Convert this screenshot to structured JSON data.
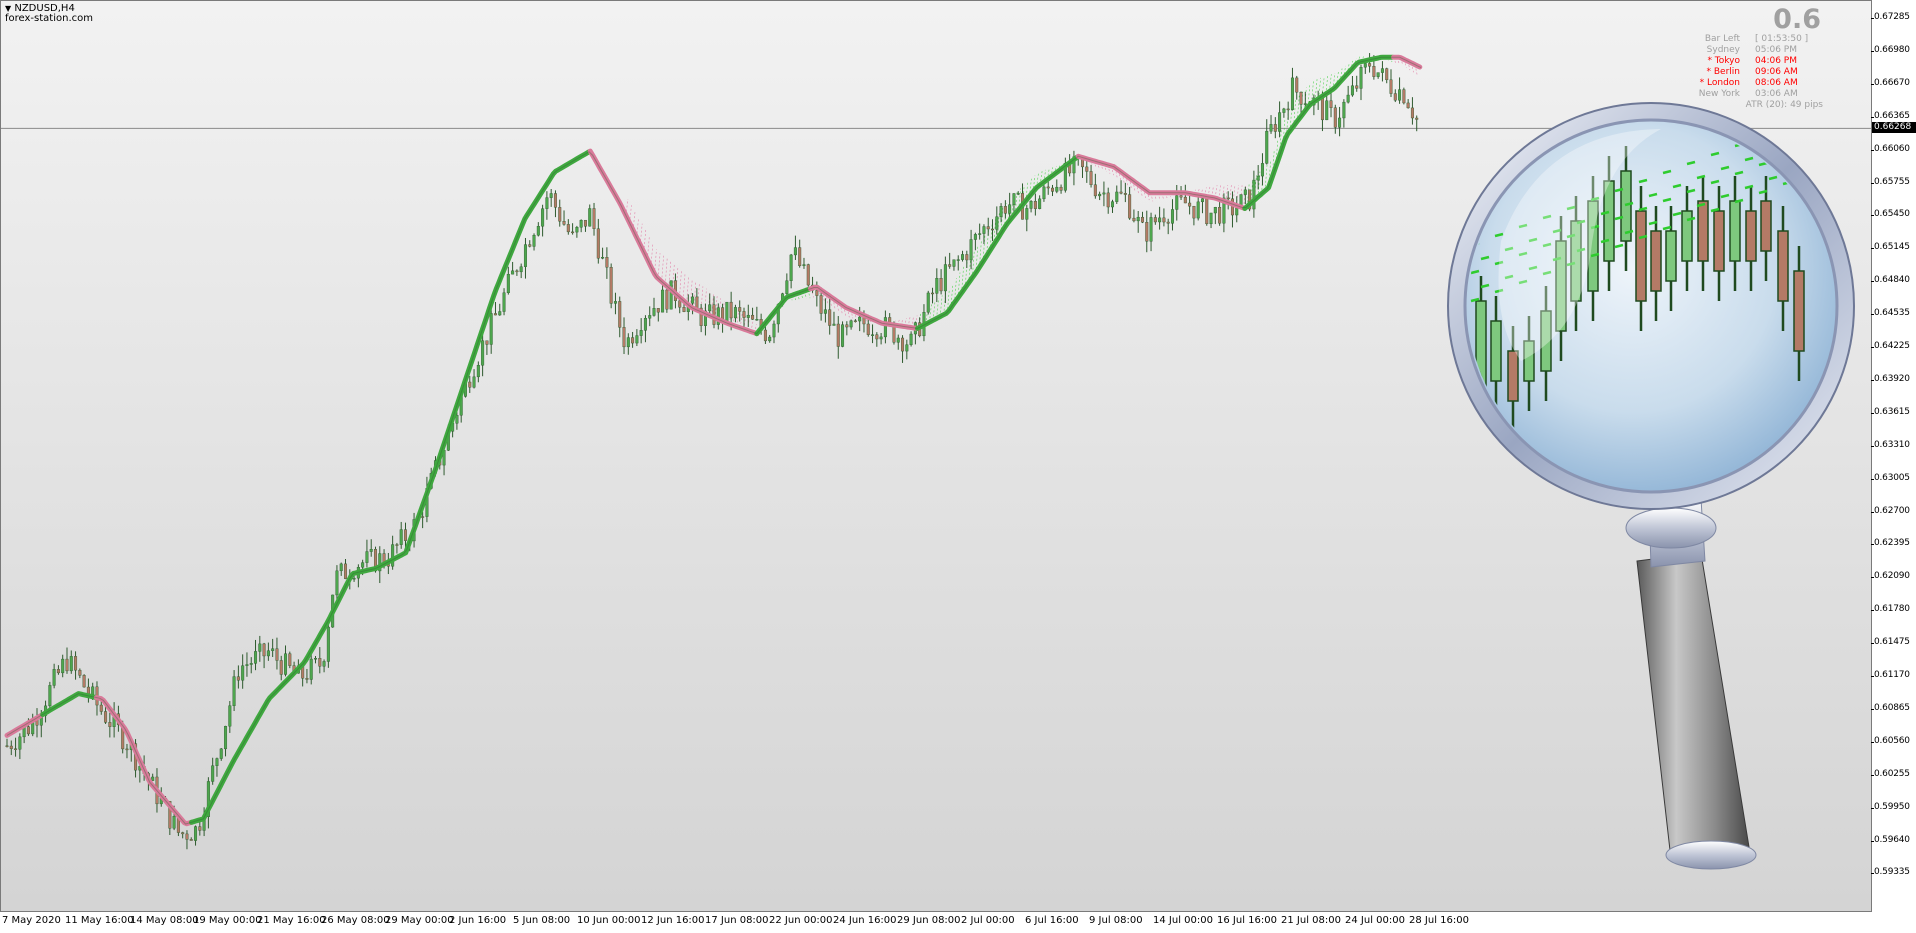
{
  "window": {
    "symbol_label": "NZDUSD,H4",
    "watermark": "forex-station.com",
    "menu_icon": "triangle-down-icon"
  },
  "info_panel": {
    "big_value": "0.6",
    "rows": [
      {
        "label": "Bar Left",
        "value": "[ 01:53:50 ]",
        "color": "#a0a0a0"
      },
      {
        "label": "Sydney",
        "value": "05:06 PM",
        "color": "#a0a0a0"
      },
      {
        "label": "* Tokyo",
        "value": "04:06 PM",
        "color": "#ff0000"
      },
      {
        "label": "* Berlin",
        "value": "09:06 AM",
        "color": "#ff0000"
      },
      {
        "label": "* London",
        "value": "08:06 AM",
        "color": "#ff0000"
      },
      {
        "label": "New York",
        "value": "03:06 AM",
        "color": "#a0a0a0"
      }
    ],
    "atr": "ATR (20): 49 pips"
  },
  "price_axis": {
    "ticks": [
      "0.67285",
      "0.66980",
      "0.66670",
      "0.66365",
      "0.66060",
      "0.65755",
      "0.65450",
      "0.65145",
      "0.64840",
      "0.64535",
      "0.64225",
      "0.63920",
      "0.63615",
      "0.63310",
      "0.63005",
      "0.62700",
      "0.62395",
      "0.62090",
      "0.61780",
      "0.61475",
      "0.61170",
      "0.60865",
      "0.60560",
      "0.60255",
      "0.59950",
      "0.59640",
      "0.59335"
    ],
    "current_price": "0.66268"
  },
  "time_axis": {
    "labels": [
      "7 May 2020",
      "11 May 16:00",
      "14 May 08:00",
      "19 May 00:00",
      "21 May 16:00",
      "26 May 08:00",
      "29 May 00:00",
      "2 Jun 16:00",
      "5 Jun 08:00",
      "10 Jun 00:00",
      "12 Jun 16:00",
      "17 Jun 08:00",
      "22 Jun 00:00",
      "24 Jun 16:00",
      "29 Jun 08:00",
      "2 Jul 00:00",
      "6 Jul 16:00",
      "9 Jul 08:00",
      "14 Jul 00:00",
      "16 Jul 16:00",
      "21 Jul 08:00",
      "24 Jul 00:00",
      "28 Jul 16:00"
    ]
  },
  "colors": {
    "bull_candle": "#4ea64e",
    "bear_candle": "#b47a66",
    "ma_up": "#3fa83f",
    "ma_down": "#d97a9a",
    "cloud_up": "#2ecc2e",
    "cloud_down": "#e06a9a"
  },
  "overlay": {
    "icon": "magnifying-glass-icon"
  },
  "chart_data": {
    "type": "candlestick",
    "symbol": "NZDUSD",
    "timeframe": "H4",
    "ylim": [
      0.5915,
      0.6745
    ],
    "x_labels": [
      "7 May 2020",
      "11 May 16:00",
      "14 May 08:00",
      "19 May 00:00",
      "21 May 16:00",
      "26 May 08:00",
      "29 May 00:00",
      "2 Jun 16:00",
      "5 Jun 08:00",
      "10 Jun 00:00",
      "12 Jun 16:00",
      "17 Jun 08:00",
      "22 Jun 00:00",
      "24 Jun 16:00",
      "29 Jun 08:00",
      "2 Jul 00:00",
      "6 Jul 16:00",
      "9 Jul 08:00",
      "14 Jul 00:00",
      "16 Jul 16:00",
      "21 Jul 08:00",
      "24 Jul 00:00",
      "28 Jul 16:00"
    ],
    "close_path": [
      [
        0,
        0.6035
      ],
      [
        20,
        0.6055
      ],
      [
        50,
        0.6118
      ],
      [
        75,
        0.6075
      ],
      [
        100,
        0.604
      ],
      [
        120,
        0.6
      ],
      [
        145,
        0.595
      ],
      [
        160,
        0.5955
      ],
      [
        175,
        0.602
      ],
      [
        195,
        0.611
      ],
      [
        220,
        0.6125
      ],
      [
        245,
        0.61
      ],
      [
        265,
        0.6115
      ],
      [
        275,
        0.6195
      ],
      [
        295,
        0.621
      ],
      [
        320,
        0.6215
      ],
      [
        345,
        0.625
      ],
      [
        365,
        0.6315
      ],
      [
        390,
        0.6395
      ],
      [
        410,
        0.6445
      ],
      [
        430,
        0.65
      ],
      [
        455,
        0.6565
      ],
      [
        475,
        0.652
      ],
      [
        490,
        0.6545
      ],
      [
        510,
        0.6455
      ],
      [
        520,
        0.642
      ],
      [
        535,
        0.645
      ],
      [
        560,
        0.647
      ],
      [
        585,
        0.6445
      ],
      [
        610,
        0.645
      ],
      [
        625,
        0.644
      ],
      [
        640,
        0.643
      ],
      [
        660,
        0.651
      ],
      [
        680,
        0.646
      ],
      [
        700,
        0.6425
      ],
      [
        720,
        0.644
      ],
      [
        740,
        0.6435
      ],
      [
        760,
        0.642
      ],
      [
        780,
        0.6475
      ],
      [
        800,
        0.65
      ],
      [
        820,
        0.653
      ],
      [
        840,
        0.6555
      ],
      [
        860,
        0.655
      ],
      [
        880,
        0.6575
      ],
      [
        900,
        0.659
      ],
      [
        920,
        0.6565
      ],
      [
        940,
        0.656
      ],
      [
        955,
        0.6525
      ],
      [
        970,
        0.6545
      ],
      [
        990,
        0.6555
      ],
      [
        1010,
        0.6545
      ],
      [
        1030,
        0.655
      ],
      [
        1045,
        0.656
      ],
      [
        1060,
        0.662
      ],
      [
        1080,
        0.6665
      ],
      [
        1100,
        0.665
      ],
      [
        1115,
        0.6635
      ],
      [
        1130,
        0.666
      ],
      [
        1145,
        0.669
      ],
      [
        1160,
        0.667
      ],
      [
        1175,
        0.666
      ],
      [
        1187,
        0.6628
      ]
    ],
    "ma_path": [
      [
        0,
        0.6045
      ],
      [
        30,
        0.6065
      ],
      [
        60,
        0.6085
      ],
      [
        80,
        0.608
      ],
      [
        100,
        0.605
      ],
      [
        120,
        0.6
      ],
      [
        150,
        0.596
      ],
      [
        165,
        0.5965
      ],
      [
        190,
        0.602
      ],
      [
        220,
        0.608
      ],
      [
        250,
        0.6115
      ],
      [
        270,
        0.6155
      ],
      [
        290,
        0.62
      ],
      [
        310,
        0.6205
      ],
      [
        335,
        0.622
      ],
      [
        360,
        0.63
      ],
      [
        385,
        0.6385
      ],
      [
        410,
        0.647
      ],
      [
        435,
        0.654
      ],
      [
        460,
        0.6585
      ],
      [
        490,
        0.6605
      ],
      [
        515,
        0.6555
      ],
      [
        545,
        0.6485
      ],
      [
        575,
        0.6455
      ],
      [
        605,
        0.644
      ],
      [
        630,
        0.643
      ],
      [
        655,
        0.6465
      ],
      [
        680,
        0.6475
      ],
      [
        705,
        0.6455
      ],
      [
        735,
        0.644
      ],
      [
        765,
        0.6435
      ],
      [
        790,
        0.645
      ],
      [
        815,
        0.649
      ],
      [
        840,
        0.6535
      ],
      [
        865,
        0.657
      ],
      [
        900,
        0.66
      ],
      [
        930,
        0.659
      ],
      [
        960,
        0.6565
      ],
      [
        990,
        0.6565
      ],
      [
        1015,
        0.656
      ],
      [
        1040,
        0.655
      ],
      [
        1060,
        0.657
      ],
      [
        1075,
        0.662
      ],
      [
        1095,
        0.665
      ],
      [
        1115,
        0.6665
      ],
      [
        1135,
        0.669
      ],
      [
        1155,
        0.6695
      ],
      [
        1170,
        0.6695
      ],
      [
        1188,
        0.6685
      ]
    ],
    "ma_direction_changes": [
      {
        "from_x": 0,
        "to_x": 30,
        "trend": "down"
      },
      {
        "from_x": 30,
        "to_x": 75,
        "trend": "up"
      },
      {
        "from_x": 75,
        "to_x": 155,
        "trend": "down"
      },
      {
        "from_x": 155,
        "to_x": 490,
        "trend": "up"
      },
      {
        "from_x": 490,
        "to_x": 630,
        "trend": "down"
      },
      {
        "from_x": 630,
        "to_x": 675,
        "trend": "up"
      },
      {
        "from_x": 675,
        "to_x": 765,
        "trend": "down"
      },
      {
        "from_x": 765,
        "to_x": 900,
        "trend": "up"
      },
      {
        "from_x": 900,
        "to_x": 1040,
        "trend": "down"
      },
      {
        "from_x": 1040,
        "to_x": 1165,
        "trend": "up"
      },
      {
        "from_x": 1165,
        "to_x": 1188,
        "trend": "down"
      }
    ]
  }
}
